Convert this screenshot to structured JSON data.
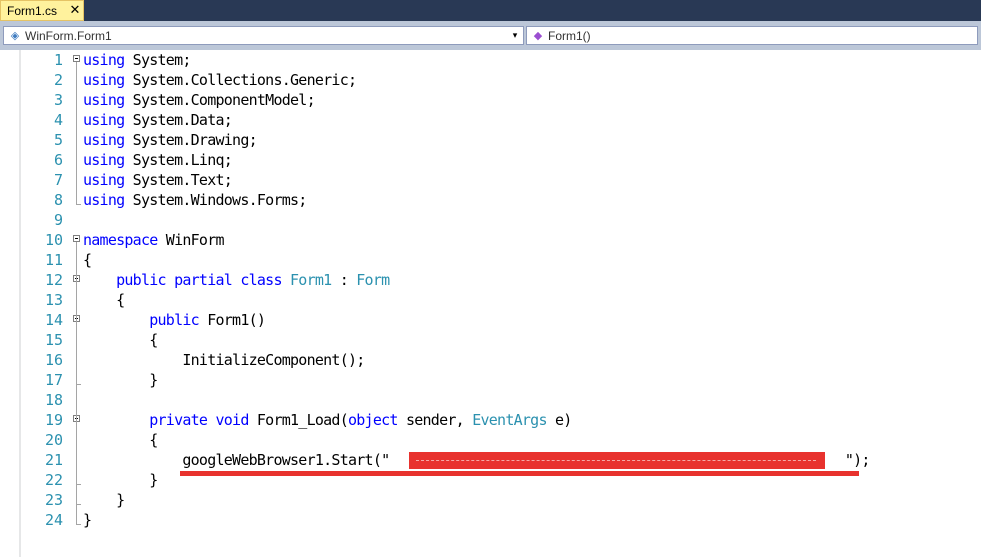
{
  "tab": {
    "label": "Form1.cs",
    "close_glyph": "✕"
  },
  "nav": {
    "class_selector": "WinForm.Form1",
    "member_selector": "Form1()",
    "dropdown_glyph": "▾"
  },
  "editor": {
    "lines": [
      {
        "n": "1",
        "tokens": [
          {
            "t": "using",
            "c": "kw"
          },
          {
            "t": " System;",
            "c": ""
          }
        ]
      },
      {
        "n": "2",
        "tokens": [
          {
            "t": "using",
            "c": "kw"
          },
          {
            "t": " System.Collections.Generic;",
            "c": ""
          }
        ]
      },
      {
        "n": "3",
        "tokens": [
          {
            "t": "using",
            "c": "kw"
          },
          {
            "t": " System.ComponentModel;",
            "c": ""
          }
        ]
      },
      {
        "n": "4",
        "tokens": [
          {
            "t": "using",
            "c": "kw"
          },
          {
            "t": " System.Data;",
            "c": ""
          }
        ]
      },
      {
        "n": "5",
        "tokens": [
          {
            "t": "using",
            "c": "kw"
          },
          {
            "t": " System.Drawing;",
            "c": ""
          }
        ]
      },
      {
        "n": "6",
        "tokens": [
          {
            "t": "using",
            "c": "kw"
          },
          {
            "t": " System.Linq;",
            "c": ""
          }
        ]
      },
      {
        "n": "7",
        "tokens": [
          {
            "t": "using",
            "c": "kw"
          },
          {
            "t": " System.Text;",
            "c": ""
          }
        ]
      },
      {
        "n": "8",
        "tokens": [
          {
            "t": "using",
            "c": "kw"
          },
          {
            "t": " System.Windows.Forms;",
            "c": ""
          }
        ]
      },
      {
        "n": "9",
        "tokens": []
      },
      {
        "n": "10",
        "tokens": [
          {
            "t": "namespace",
            "c": "kw"
          },
          {
            "t": " WinForm",
            "c": ""
          }
        ]
      },
      {
        "n": "11",
        "tokens": [
          {
            "t": "{",
            "c": ""
          }
        ]
      },
      {
        "n": "12",
        "tokens": [
          {
            "t": "    ",
            "c": ""
          },
          {
            "t": "public",
            "c": "kw"
          },
          {
            "t": " ",
            "c": ""
          },
          {
            "t": "partial",
            "c": "kw"
          },
          {
            "t": " ",
            "c": ""
          },
          {
            "t": "class",
            "c": "kw"
          },
          {
            "t": " ",
            "c": ""
          },
          {
            "t": "Form1",
            "c": "ty"
          },
          {
            "t": " : ",
            "c": ""
          },
          {
            "t": "Form",
            "c": "ty"
          }
        ]
      },
      {
        "n": "13",
        "tokens": [
          {
            "t": "    {",
            "c": ""
          }
        ]
      },
      {
        "n": "14",
        "tokens": [
          {
            "t": "        ",
            "c": ""
          },
          {
            "t": "public",
            "c": "kw"
          },
          {
            "t": " Form1()",
            "c": ""
          }
        ]
      },
      {
        "n": "15",
        "tokens": [
          {
            "t": "        {",
            "c": ""
          }
        ]
      },
      {
        "n": "16",
        "tokens": [
          {
            "t": "            InitializeComponent();",
            "c": ""
          }
        ]
      },
      {
        "n": "17",
        "tokens": [
          {
            "t": "        }",
            "c": ""
          }
        ]
      },
      {
        "n": "18",
        "tokens": []
      },
      {
        "n": "19",
        "tokens": [
          {
            "t": "        ",
            "c": ""
          },
          {
            "t": "private",
            "c": "kw"
          },
          {
            "t": " ",
            "c": ""
          },
          {
            "t": "void",
            "c": "kw"
          },
          {
            "t": " Form1_Load(",
            "c": ""
          },
          {
            "t": "object",
            "c": "kw"
          },
          {
            "t": " sender, ",
            "c": ""
          },
          {
            "t": "EventArgs",
            "c": "ty"
          },
          {
            "t": " e)",
            "c": ""
          }
        ]
      },
      {
        "n": "20",
        "tokens": [
          {
            "t": "        {",
            "c": ""
          }
        ]
      },
      {
        "n": "21",
        "tokens": [
          {
            "t": "            googleWebBrowser1.Start(",
            "c": ""
          },
          {
            "t": "\"",
            "c": ""
          },
          {
            "t": "                                                       ",
            "c": ""
          },
          {
            "t": "\");",
            "c": ""
          }
        ]
      },
      {
        "n": "22",
        "tokens": [
          {
            "t": "        }",
            "c": ""
          }
        ]
      },
      {
        "n": "23",
        "tokens": [
          {
            "t": "    }",
            "c": ""
          }
        ]
      },
      {
        "n": "24",
        "tokens": [
          {
            "t": "}",
            "c": ""
          }
        ]
      }
    ]
  }
}
